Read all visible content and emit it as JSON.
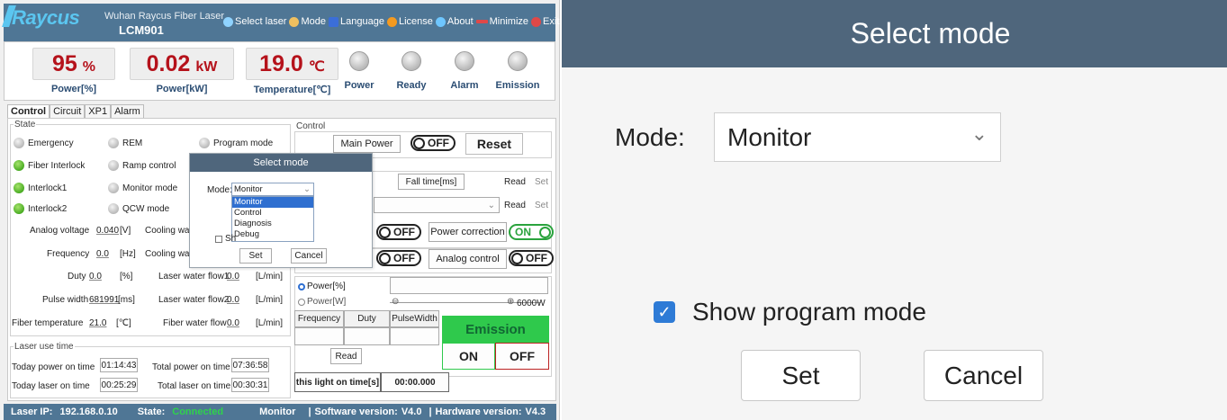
{
  "titlebar": {
    "company": "Wuhan Raycus Fiber Laser",
    "model": "LCM901",
    "logo": "Raycus",
    "menu": [
      {
        "label": "Select laser",
        "icon": "laser-select-icon",
        "color": "#8fd3ff"
      },
      {
        "label": "Mode",
        "icon": "mode-icon",
        "color": "#f0c060"
      },
      {
        "label": "Language",
        "icon": "language-icon",
        "color": "#3b6ed8"
      },
      {
        "label": "License",
        "icon": "license-icon",
        "color": "#f59a20"
      },
      {
        "label": "About",
        "icon": "about-icon",
        "color": "#6ec6ff"
      },
      {
        "label": "Minimize",
        "icon": "minimize-icon",
        "color": "#e04848"
      },
      {
        "label": "Exit",
        "icon": "exit-icon",
        "color": "#e04848"
      }
    ]
  },
  "metrics": {
    "power_pct": {
      "value": "95",
      "unit": "%",
      "label": "Power[%]"
    },
    "power_kw": {
      "value": "0.02",
      "unit": "kW",
      "label": "Power[kW]"
    },
    "temperature": {
      "value": "19.0",
      "unit": "℃",
      "label": "Temperature[℃]"
    },
    "indicators": [
      "Power",
      "Ready",
      "Alarm",
      "Emission"
    ]
  },
  "tabs": [
    "Control",
    "Circuit",
    "XP1",
    "Alarm"
  ],
  "state": {
    "title": "State",
    "leds": [
      {
        "label": "Emergency",
        "color": "gray"
      },
      {
        "label": "REM",
        "color": "gray"
      },
      {
        "label": "Program mode",
        "color": "gray"
      },
      {
        "label": "Fiber Interlock",
        "color": "green"
      },
      {
        "label": "Ramp control",
        "color": "gray"
      },
      {
        "label": "Interlock1",
        "color": "green"
      },
      {
        "label": "Monitor mode",
        "color": "gray"
      },
      {
        "label": "Interlock2",
        "color": "green"
      },
      {
        "label": "QCW mode",
        "color": "gray"
      }
    ],
    "readings": [
      {
        "label": "Analog voltage",
        "value": "0.040",
        "unit": "[V]"
      },
      {
        "label": "Frequency",
        "value": "0.0",
        "unit": "[Hz]"
      },
      {
        "label": "Duty",
        "value": "0.0",
        "unit": "[%]"
      },
      {
        "label": "Pulse width",
        "value": "681991",
        "unit": "[ms]"
      },
      {
        "label": "Fiber temperature",
        "value": "21.0",
        "unit": "[℃]"
      }
    ],
    "cooling": [
      {
        "label": "Cooling wat"
      },
      {
        "label": "Cooling wat"
      },
      {
        "label": "Laser water flow1",
        "value": "0.0",
        "unit": "[L/min]"
      },
      {
        "label": "Laser water flow2",
        "value": "0.0",
        "unit": "[L/min]"
      },
      {
        "label": "Fiber water flow",
        "value": "0.0",
        "unit": "[L/min]"
      }
    ]
  },
  "usetime": {
    "title": "Laser use time",
    "today_power_label": "Today power on time",
    "today_power": "01:14:43",
    "total_power_label": "Total power on time",
    "total_power": "07:36:58",
    "today_laser_label": "Today laser on time",
    "today_laser": "00:25:29",
    "total_laser_label": "Total laser on time",
    "total_laser": "00:30:31"
  },
  "control": {
    "title": "Control",
    "main_power": "Main Power",
    "toggle_off": "OFF",
    "toggle_on": "ON",
    "reset": "Reset",
    "fall_time": "Fall time[ms]",
    "read": "Read",
    "set": "Set",
    "power_correction": "Power correction",
    "analog_control": "Analog control",
    "radio_power_pct": "Power[%]",
    "radio_power_w": "Power[W]",
    "slider_max": "6000W",
    "col_frequency": "Frequency",
    "col_duty": "Duty",
    "col_pulsewidth": "PulseWidth",
    "emission": "Emission",
    "on": "ON",
    "off": "OFF",
    "light_on_label": "this light on time[s]",
    "light_on_value": "00:00.000"
  },
  "popup": {
    "title": "Select mode",
    "mode_label": "Mode:",
    "selected": "Monitor",
    "options": [
      "Monitor",
      "Control",
      "Diagnosis",
      "Debug"
    ],
    "show_program_partial": "Sh",
    "set": "Set",
    "cancel": "Cancel"
  },
  "statusbar": {
    "ip_label": "Laser IP:",
    "ip": "192.168.0.10",
    "state_label": "State:",
    "state": "Connected",
    "mode": "Monitor",
    "software_label": "Software version:",
    "software": "V4.0",
    "hardware_label": "Hardware version:",
    "hardware": "V4.3"
  },
  "zoom": {
    "title": "Select mode",
    "mode_label": "Mode:",
    "selected": "Monitor",
    "show_program": "Show program mode",
    "set": "Set",
    "cancel": "Cancel"
  }
}
